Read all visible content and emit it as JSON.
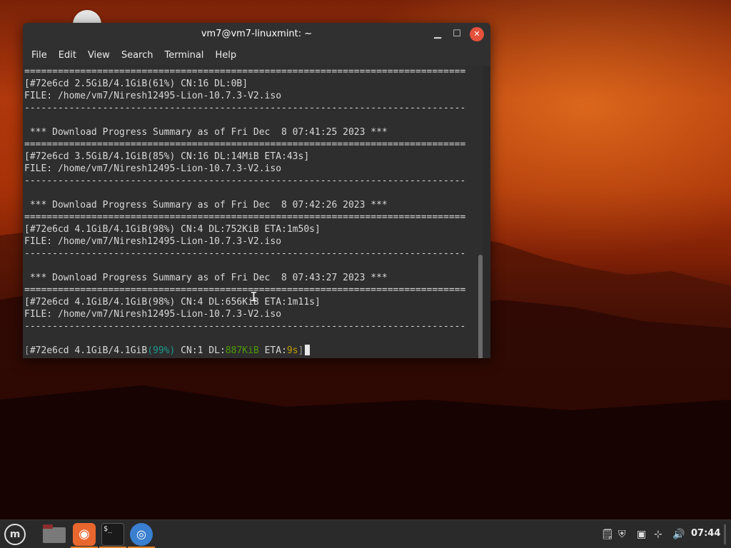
{
  "window": {
    "title": "vm7@vm7-linuxmint: ~",
    "controls": {
      "minimize": "▁",
      "maximize": "☐",
      "close": "✕"
    }
  },
  "menubar": [
    "File",
    "Edit",
    "View",
    "Search",
    "Terminal",
    "Help"
  ],
  "terminal": {
    "lines": [
      "===============================================================================",
      "[#72e6cd 2.5GiB/4.1GiB(61%) CN:16 DL:0B]",
      "FILE: /home/vm7/Niresh12495-Lion-10.7.3-V2.iso",
      "-------------------------------------------------------------------------------",
      "",
      " *** Download Progress Summary as of Fri Dec  8 07:41:25 2023 ***",
      "===============================================================================",
      "[#72e6cd 3.5GiB/4.1GiB(85%) CN:16 DL:14MiB ETA:43s]",
      "FILE: /home/vm7/Niresh12495-Lion-10.7.3-V2.iso",
      "-------------------------------------------------------------------------------",
      "",
      " *** Download Progress Summary as of Fri Dec  8 07:42:26 2023 ***",
      "===============================================================================",
      "[#72e6cd 4.1GiB/4.1GiB(98%) CN:4 DL:752KiB ETA:1m50s]",
      "FILE: /home/vm7/Niresh12495-Lion-10.7.3-V2.iso",
      "-------------------------------------------------------------------------------",
      "",
      " *** Download Progress Summary as of Fri Dec  8 07:43:27 2023 ***",
      "===============================================================================",
      "[#72e6cd 4.1GiB/4.1GiB(98%) CN:4 DL:656KiB ETA:1m11s]",
      "FILE: /home/vm7/Niresh12495-Lion-10.7.3-V2.iso",
      "-------------------------------------------------------------------------------",
      ""
    ],
    "progress_line": {
      "open": "[",
      "id_size": "#72e6cd 4.1GiB/4.1GiB",
      "percent": "(99%)",
      "cn": " CN:1 DL:",
      "speed": "887KiB",
      "eta_label": " ETA:",
      "eta": "9s",
      "close": "]"
    }
  },
  "taskbar": {
    "menu_label": "m",
    "firefox_glyph": "◉",
    "terminal_glyph": "$_",
    "web_glyph": "◎",
    "tray": {
      "notes": "🗒",
      "shield": "⛨",
      "clipboard": "▣",
      "network": "⊹",
      "volume": "🔊"
    },
    "clock": "07:44"
  },
  "colors": {
    "terminal_bg": "#2e2e2e",
    "percent": "#1d9a8e",
    "speed": "#4e9a06",
    "eta": "#c4a000"
  }
}
